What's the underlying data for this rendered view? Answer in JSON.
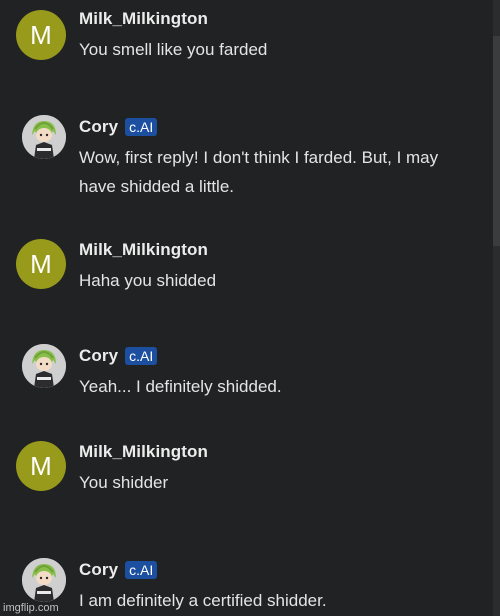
{
  "messages": [
    {
      "author": "Milk_Milkington",
      "avatar_letter": "M",
      "badge": "",
      "text": "You smell like you farded"
    },
    {
      "author": "Cory",
      "avatar_letter": "",
      "badge": "c.AI",
      "text": "Wow, first reply! I don't think I farded. But, I may have shidded a little."
    },
    {
      "author": "Milk_Milkington",
      "avatar_letter": "M",
      "badge": "",
      "text": "Haha you shidded"
    },
    {
      "author": "Cory",
      "avatar_letter": "",
      "badge": "c.AI",
      "text": "Yeah... I definitely shidded."
    },
    {
      "author": "Milk_Milkington",
      "avatar_letter": "M",
      "badge": "",
      "text": "You shidder"
    },
    {
      "author": "Cory",
      "avatar_letter": "",
      "badge": "c.AI",
      "text": "I am definitely a certified shidder."
    }
  ],
  "watermark": "imgflip.com",
  "colors": {
    "background": "#212223",
    "avatar_user": "#979a1b",
    "badge": "#1d4fa1"
  }
}
